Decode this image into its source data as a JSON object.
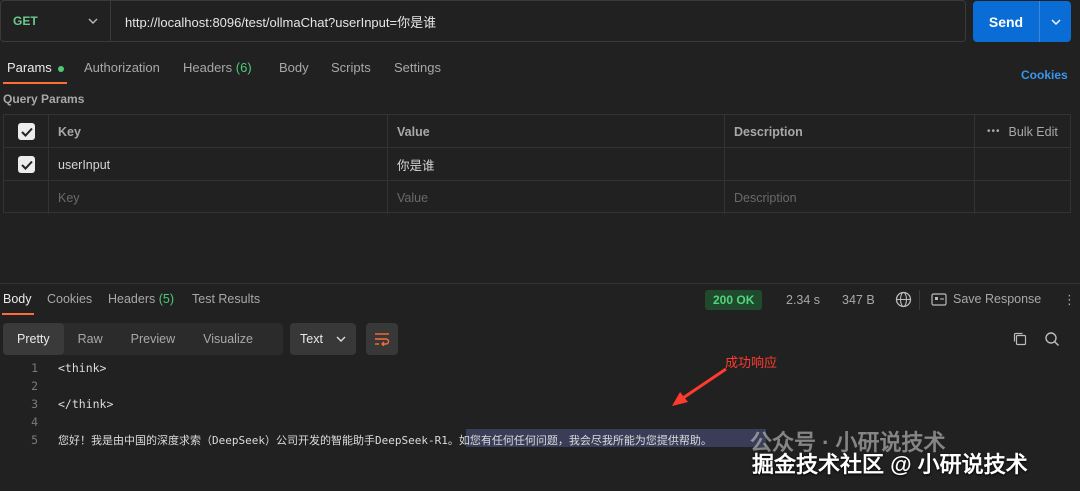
{
  "request": {
    "method": "GET",
    "url": "http://localhost:8096/test/ollmaChat?userInput=你是谁",
    "send_label": "Send"
  },
  "request_tabs": {
    "params": "Params",
    "authorization": "Authorization",
    "headers": "Headers",
    "headers_count": "(6)",
    "body": "Body",
    "scripts": "Scripts",
    "settings": "Settings",
    "cookies": "Cookies"
  },
  "query_params": {
    "title": "Query Params",
    "columns": {
      "key": "Key",
      "value": "Value",
      "description": "Description",
      "bulk_edit": "Bulk Edit"
    },
    "rows": [
      {
        "key": "userInput",
        "value": "你是谁",
        "description": ""
      }
    ],
    "placeholders": {
      "key": "Key",
      "value": "Value",
      "description": "Description"
    }
  },
  "response_tabs": {
    "body": "Body",
    "cookies": "Cookies",
    "headers": "Headers",
    "headers_count": "(5)",
    "test_results": "Test Results"
  },
  "response_meta": {
    "status": "200 OK",
    "time": "2.34 s",
    "size": "347 B",
    "save": "Save Response"
  },
  "view": {
    "modes": [
      "Pretty",
      "Raw",
      "Preview",
      "Visualize"
    ],
    "active": "Pretty",
    "format": "Text"
  },
  "code_lines": [
    {
      "n": "1",
      "text": "<think>"
    },
    {
      "n": "2",
      "text": ""
    },
    {
      "n": "3",
      "text": "</think>"
    },
    {
      "n": "4",
      "text": ""
    },
    {
      "n": "5",
      "text": "您好！我是由中国的深度求索（DeepSeek）公司开发的智能助手DeepSeek-R1。如您有任何任何问题，我会尽我所能为您提供帮助。"
    }
  ],
  "annotation": "成功响应",
  "watermark": {
    "line1": "公众号 · 小研说技术",
    "line2": "掘金技术社区 @ 小研说技术"
  },
  "colors": {
    "accent": "#ff6c37",
    "send": "#0a6dd6",
    "status_ok": "#54d37f",
    "method_get": "#6bc98e",
    "annotation": "#ff3b2f"
  }
}
